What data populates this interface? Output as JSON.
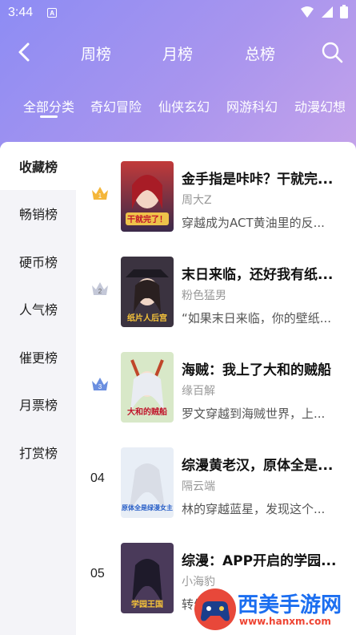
{
  "status": {
    "time": "3:44",
    "notif": "A"
  },
  "tabs": [
    {
      "label": "周榜",
      "active": false
    },
    {
      "label": "月榜",
      "active": false
    },
    {
      "label": "总榜",
      "active": true
    }
  ],
  "categories": [
    {
      "label": "全部分类",
      "active": true
    },
    {
      "label": "奇幻冒险"
    },
    {
      "label": "仙侠玄幻"
    },
    {
      "label": "网游科幻"
    },
    {
      "label": "动漫幻想"
    }
  ],
  "sidebar": [
    {
      "label": "收藏榜",
      "active": true
    },
    {
      "label": "畅销榜"
    },
    {
      "label": "硬币榜"
    },
    {
      "label": "人气榜"
    },
    {
      "label": "催更榜"
    },
    {
      "label": "月票榜"
    },
    {
      "label": "打赏榜"
    }
  ],
  "books": [
    {
      "rank": "1",
      "title": "金手指是咔咔？干就完...",
      "author": "周大Z",
      "desc": " 穿越成为ACT黄油里的反...",
      "cover_text": "干就完了！",
      "crown": "gold"
    },
    {
      "rank": "2",
      "title": "末日来临，还好我有纸...",
      "author": "粉色猛男",
      "desc": "“如果末日来临，你的壁纸...",
      "cover_text": "纸片人后宫",
      "crown": "silver"
    },
    {
      "rank": "3",
      "title": "海贼：我上了大和的贼船",
      "author": "缘百解",
      "desc": "罗文穿越到海贼世界，上...",
      "cover_text": "大和的贼船",
      "crown": "blue"
    },
    {
      "rank": "04",
      "title": "综漫黄老汉，原体全是...",
      "author": "隔云端",
      "desc": "林的穿越蓝星，发现这个...",
      "cover_text": "原体全是绿漫女主",
      "crown": ""
    },
    {
      "rank": "05",
      "title": "综漫：APP开启的学园...",
      "author": "小海豹",
      "desc": "转生...",
      "cover_text": "学园王国",
      "crown": ""
    }
  ],
  "watermark": {
    "text": "西美手游网",
    "url": "www.hanxm.com"
  },
  "colors": {
    "header_start": "#8d8cf4",
    "header_end": "#c5a3ea",
    "watermark_blue": "#1b6ef0"
  }
}
